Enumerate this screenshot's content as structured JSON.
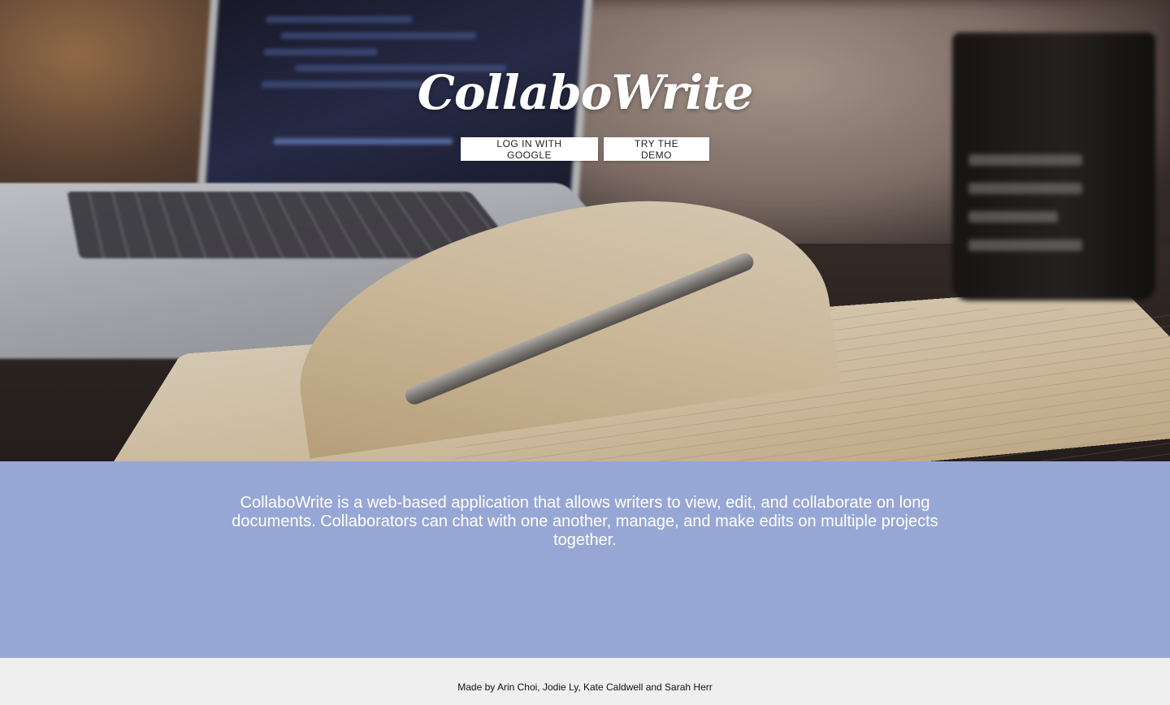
{
  "hero": {
    "brand": "CollaboWrite",
    "buttons": {
      "google_label": "LOG IN WITH GOOGLE",
      "demo_label": "TRY THE DEMO"
    }
  },
  "about": {
    "description": "CollaboWrite is a web-based application that allows writers to view, edit, and collaborate on long documents. Collaborators can chat with one another, manage, and make edits on multiple projects together."
  },
  "footer": {
    "credits": "Made by Arin Choi, Jodie Ly, Kate Caldwell and Sarah Herr"
  },
  "colors": {
    "about_background": "#97a7d5",
    "footer_background": "#efefef",
    "button_background": "#ffffff"
  }
}
